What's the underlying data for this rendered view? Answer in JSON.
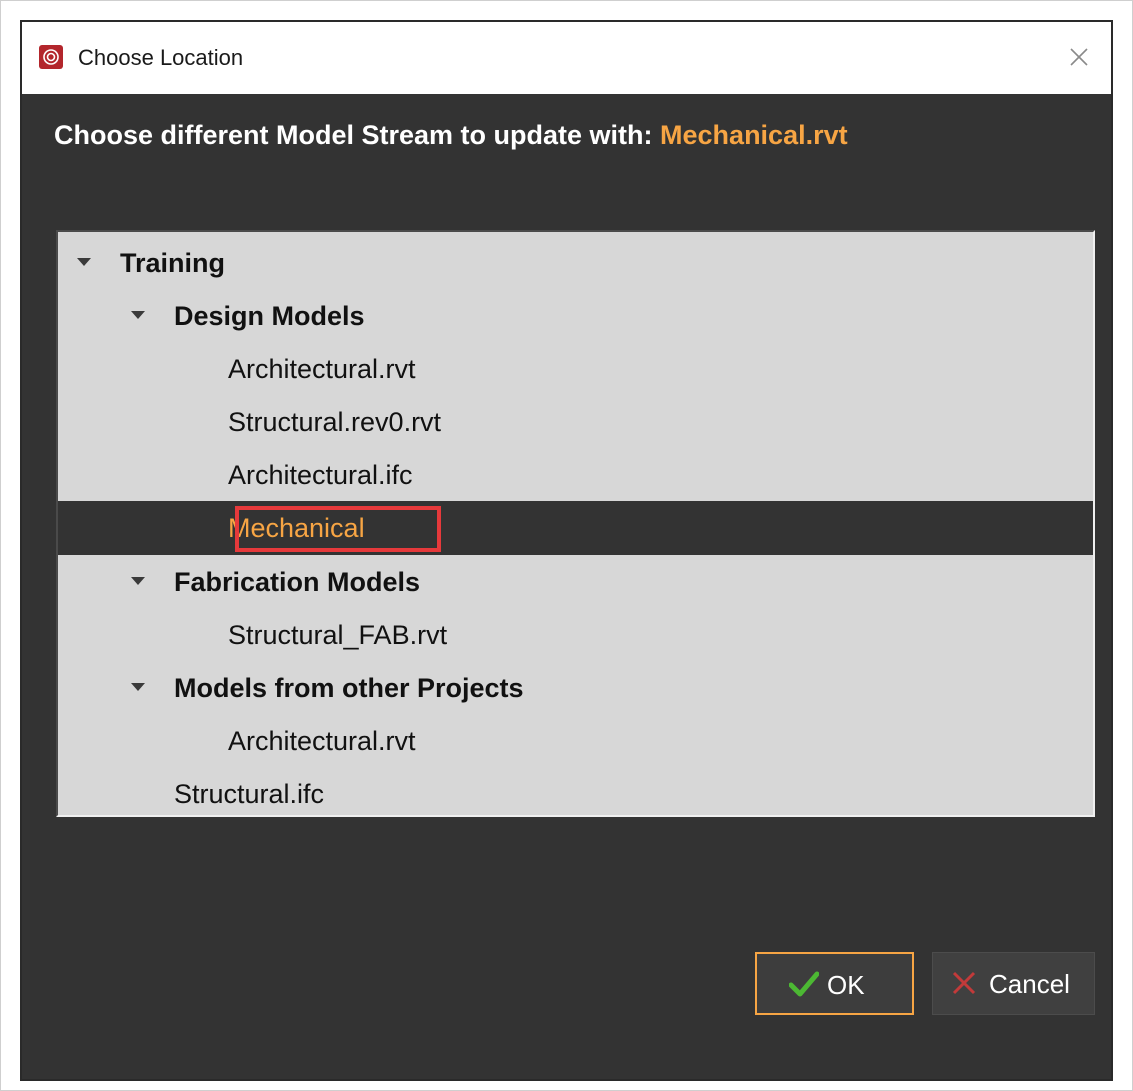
{
  "window": {
    "title": "Choose Location",
    "close_icon": "close-icon",
    "app_icon": "app-logo-icon"
  },
  "heading": {
    "prefix": "Choose different Model Stream to update with: ",
    "filename": "Mechanical.rvt"
  },
  "tree": {
    "items": [
      {
        "label": "Training",
        "level": 0,
        "expanded": true,
        "bold": true
      },
      {
        "label": "Design Models",
        "level": 1,
        "expanded": true,
        "bold": true
      },
      {
        "label": "Architectural.rvt",
        "level": 2
      },
      {
        "label": "Structural.rev0.rvt",
        "level": 2
      },
      {
        "label": "Architectural.ifc",
        "level": 2
      },
      {
        "label": "Mechanical",
        "level": 2,
        "selected": true
      },
      {
        "label": "Fabrication Models",
        "level": 1,
        "expanded": true,
        "bold": true
      },
      {
        "label": "Structural_FAB.rvt",
        "level": 2
      },
      {
        "label": "Models from other Projects",
        "level": 1,
        "expanded": true,
        "bold": true
      },
      {
        "label": "Architectural.rvt",
        "level": 2
      },
      {
        "label": "Structural.ifc",
        "level": 1
      }
    ]
  },
  "buttons": {
    "ok_label": "OK",
    "cancel_label": "Cancel"
  },
  "colors": {
    "accent": "#f7a544",
    "dialog_bg": "#333333",
    "tree_bg": "#d7d7d7",
    "highlight_box": "#e6393b",
    "ok_check": "#4cb833",
    "cancel_x": "#c23a3a"
  }
}
